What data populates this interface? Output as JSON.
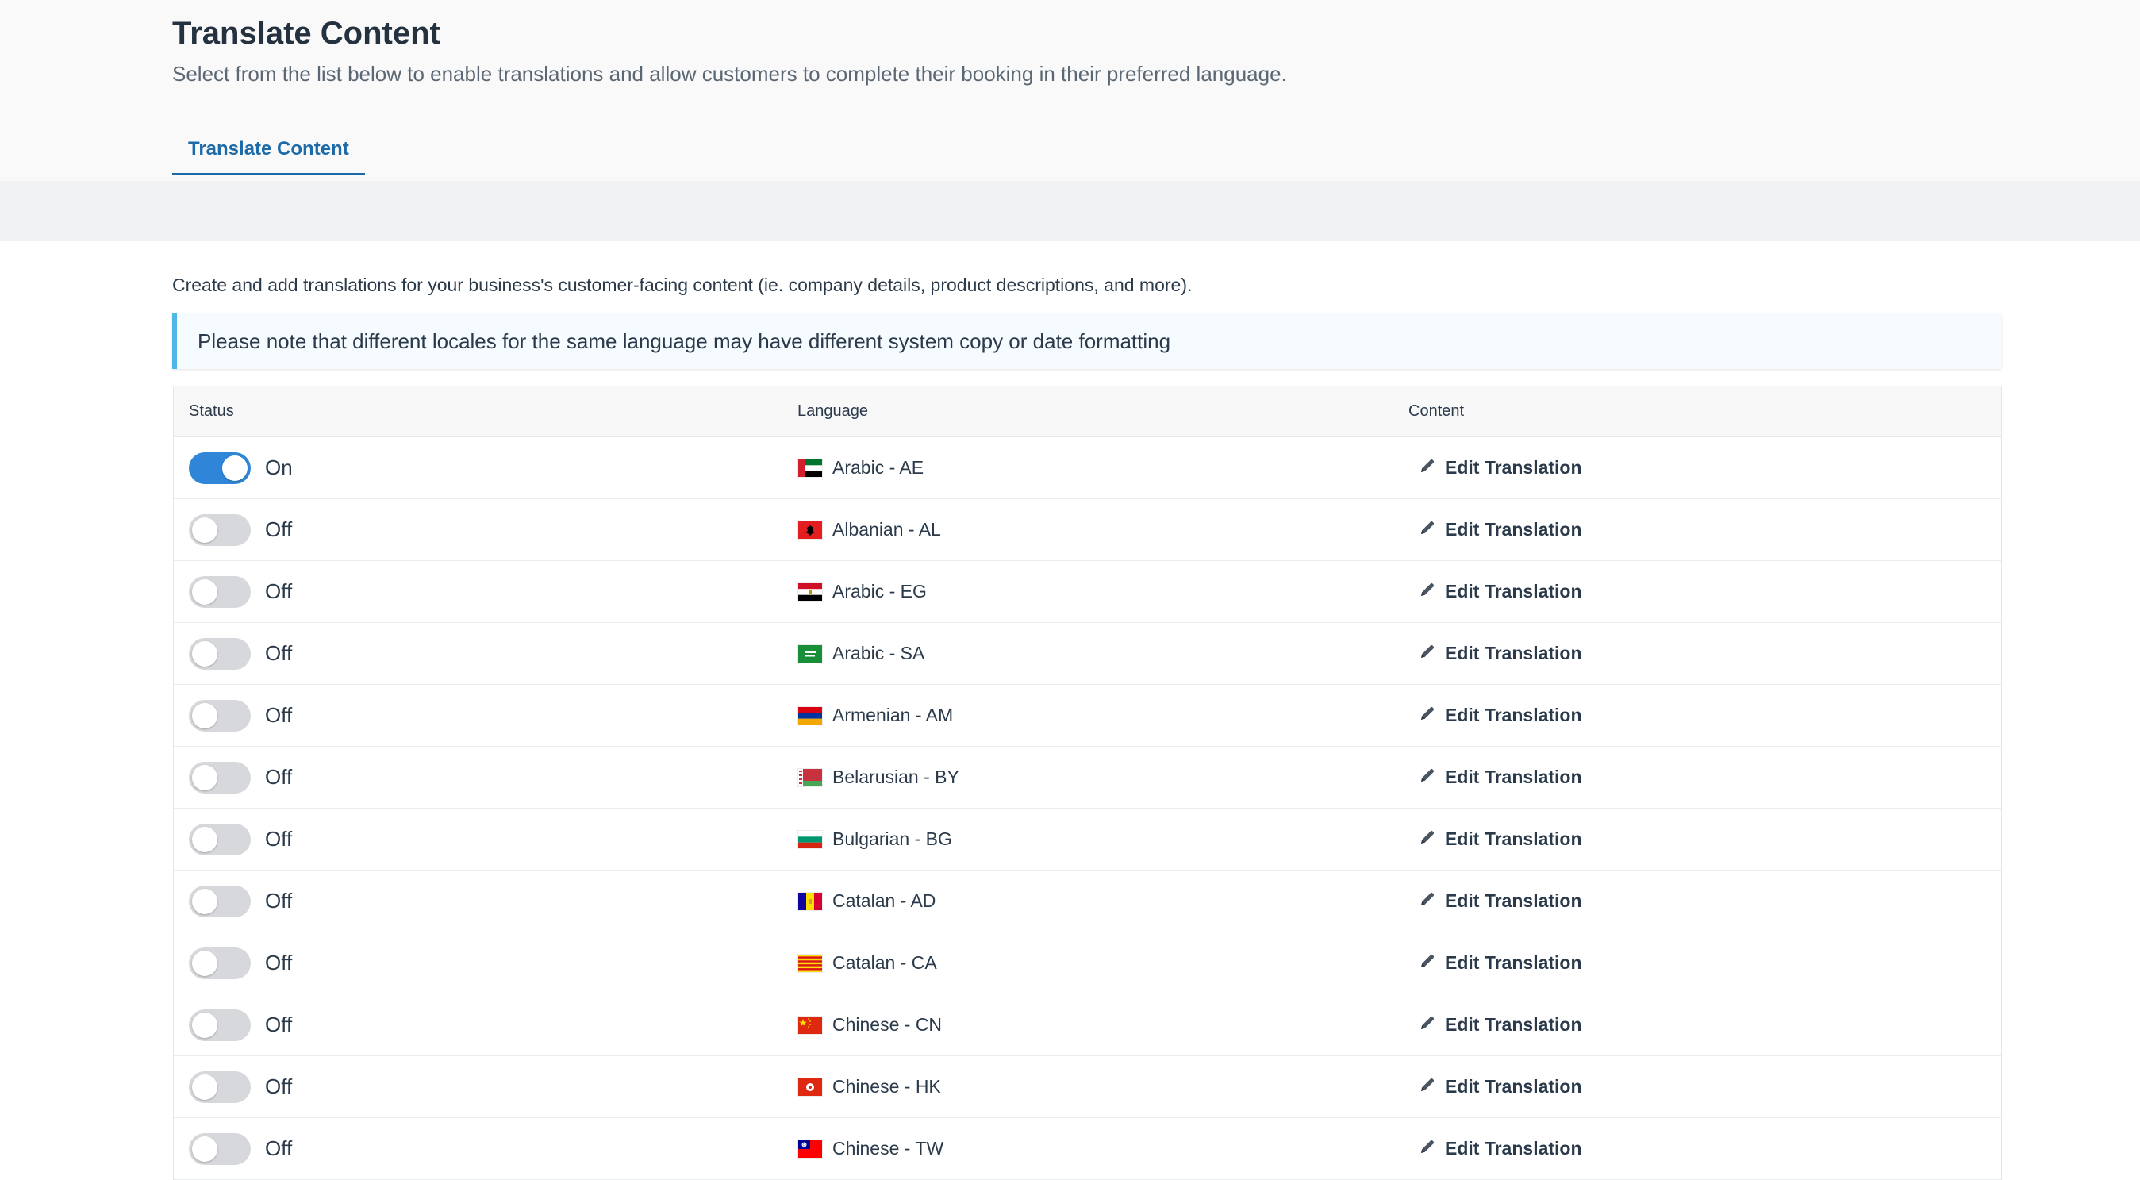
{
  "header": {
    "title": "Translate Content",
    "subtitle": "Select from the list below to enable translations and allow customers to complete their booking in their preferred language.",
    "tabs": [
      {
        "label": "Translate Content",
        "active": true
      }
    ]
  },
  "main": {
    "intro": "Create and add translations for your business's customer-facing content (ie. company details, product descriptions, and more).",
    "note": "Please note that different locales for the same language may have different system copy or date formatting"
  },
  "table": {
    "columns": [
      "Status",
      "Language",
      "Content"
    ],
    "edit_label": "Edit Translation",
    "rows": [
      {
        "enabled": true,
        "status": "On",
        "language": "Arabic - AE",
        "flag": "ae"
      },
      {
        "enabled": false,
        "status": "Off",
        "language": "Albanian - AL",
        "flag": "al"
      },
      {
        "enabled": false,
        "status": "Off",
        "language": "Arabic - EG",
        "flag": "eg"
      },
      {
        "enabled": false,
        "status": "Off",
        "language": "Arabic - SA",
        "flag": "sa"
      },
      {
        "enabled": false,
        "status": "Off",
        "language": "Armenian - AM",
        "flag": "am"
      },
      {
        "enabled": false,
        "status": "Off",
        "language": "Belarusian - BY",
        "flag": "by"
      },
      {
        "enabled": false,
        "status": "Off",
        "language": "Bulgarian - BG",
        "flag": "bg"
      },
      {
        "enabled": false,
        "status": "Off",
        "language": "Catalan - AD",
        "flag": "ad"
      },
      {
        "enabled": false,
        "status": "Off",
        "language": "Catalan - CA",
        "flag": "ca"
      },
      {
        "enabled": false,
        "status": "Off",
        "language": "Chinese - CN",
        "flag": "cn"
      },
      {
        "enabled": false,
        "status": "Off",
        "language": "Chinese - HK",
        "flag": "hk"
      },
      {
        "enabled": false,
        "status": "Off",
        "language": "Chinese - TW",
        "flag": "tw"
      }
    ]
  },
  "colors": {
    "accent": "#1d6aa8",
    "toggle_on": "#2f86d8",
    "toggle_off": "#d6d8db",
    "note_border": "#4fb6e8"
  },
  "icons": {
    "edit": "pencil-icon"
  }
}
